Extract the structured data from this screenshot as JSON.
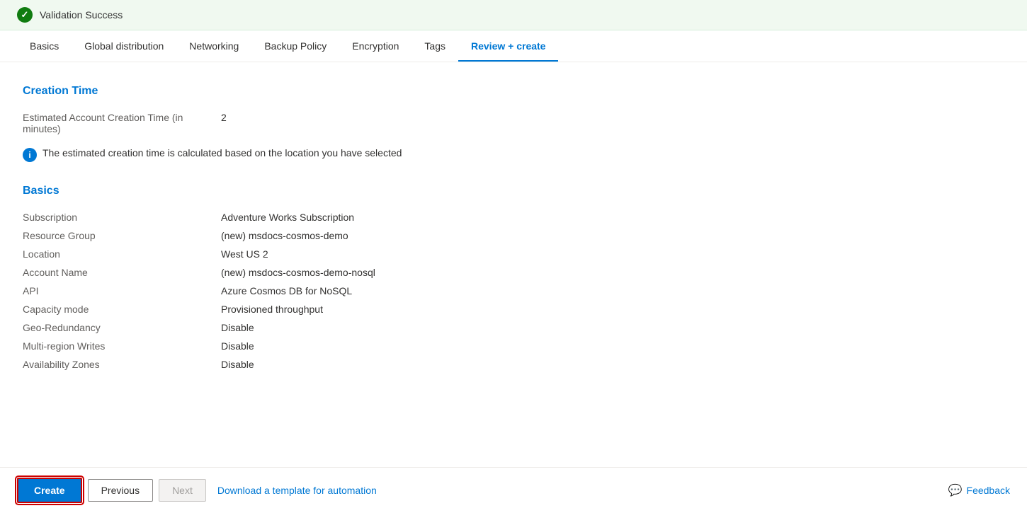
{
  "validation": {
    "status": "Validation Success",
    "icon": "✓"
  },
  "tabs": [
    {
      "id": "basics",
      "label": "Basics",
      "active": false
    },
    {
      "id": "global-distribution",
      "label": "Global distribution",
      "active": false
    },
    {
      "id": "networking",
      "label": "Networking",
      "active": false
    },
    {
      "id": "backup-policy",
      "label": "Backup Policy",
      "active": false
    },
    {
      "id": "encryption",
      "label": "Encryption",
      "active": false
    },
    {
      "id": "tags",
      "label": "Tags",
      "active": false
    },
    {
      "id": "review-create",
      "label": "Review + create",
      "active": true
    }
  ],
  "creation_time_section": {
    "title": "Creation Time",
    "fields": [
      {
        "label": "Estimated Account Creation Time (in minutes)",
        "value": "2"
      }
    ],
    "note": "The estimated creation time is calculated based on the location you have selected"
  },
  "basics_section": {
    "title": "Basics",
    "fields": [
      {
        "label": "Subscription",
        "value": "Adventure Works Subscription"
      },
      {
        "label": "Resource Group",
        "value": "(new) msdocs-cosmos-demo"
      },
      {
        "label": "Location",
        "value": "West US 2"
      },
      {
        "label": "Account Name",
        "value": "(new) msdocs-cosmos-demo-nosql"
      },
      {
        "label": "API",
        "value": "Azure Cosmos DB for NoSQL"
      },
      {
        "label": "Capacity mode",
        "value": "Provisioned throughput"
      },
      {
        "label": "Geo-Redundancy",
        "value": "Disable"
      },
      {
        "label": "Multi-region Writes",
        "value": "Disable"
      },
      {
        "label": "Availability Zones",
        "value": "Disable"
      }
    ]
  },
  "footer": {
    "create_label": "Create",
    "previous_label": "Previous",
    "next_label": "Next",
    "download_label": "Download a template for automation",
    "feedback_label": "Feedback"
  }
}
